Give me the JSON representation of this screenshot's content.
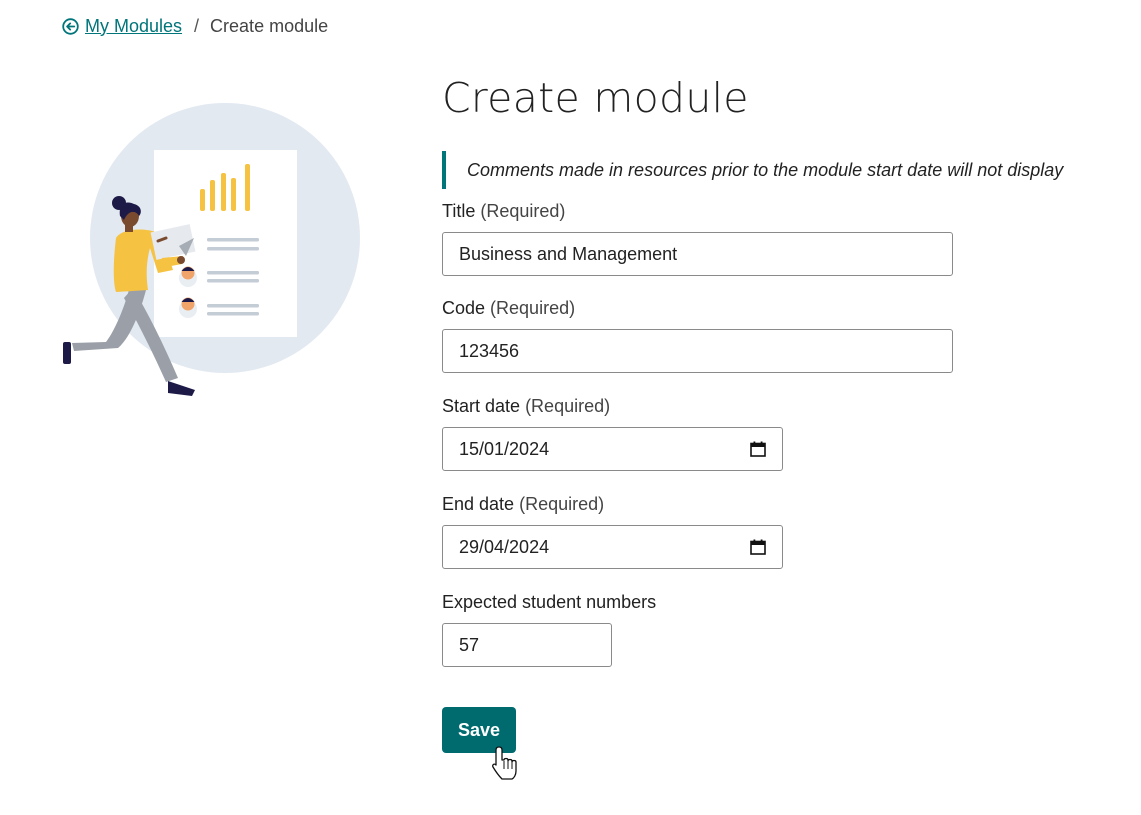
{
  "breadcrumb": {
    "back_label": "My Modules",
    "separator": "/",
    "current": "Create module",
    "icon": "circle-arrow-left-icon"
  },
  "page": {
    "title": "Create module",
    "note": "Comments made in resources prior to the module start date will not display"
  },
  "fields": {
    "title": {
      "label": "Title",
      "required": "(Required)",
      "value": "Business and Management"
    },
    "code": {
      "label": "Code",
      "required": "(Required)",
      "value": "123456"
    },
    "start_date": {
      "label": "Start date",
      "required": "(Required)",
      "value": "15/01/2024",
      "icon": "calendar-icon"
    },
    "end_date": {
      "label": "End date",
      "required": "(Required)",
      "value": "29/04/2024",
      "icon": "calendar-icon"
    },
    "students": {
      "label": "Expected student numbers",
      "value": "57"
    }
  },
  "actions": {
    "save_label": "Save"
  },
  "colors": {
    "accent": "#00757a",
    "button": "#006b6f",
    "chart_yellow": "#f5c242",
    "circle": "#e2e9f1"
  }
}
